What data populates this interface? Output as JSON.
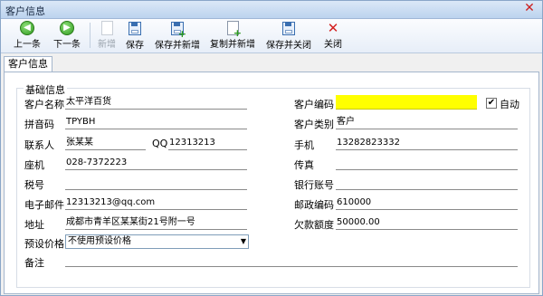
{
  "window": {
    "title": "客户信息"
  },
  "toolbar": {
    "prev_label": "上一条",
    "next_label": "下一条",
    "new_label": "新增",
    "save_label": "保存",
    "save_new_label": "保存并新增",
    "copy_new_label": "复制并新增",
    "save_close_label": "保存并关闭",
    "close_label": "关闭"
  },
  "tabs": [
    {
      "label": "客户信息"
    }
  ],
  "form": {
    "group_title": "基础信息",
    "name_label": "客户名称",
    "name_value": "太平洋百货",
    "code_label": "客户编码",
    "code_value": "",
    "auto_label": "自动",
    "auto_checked_glyph": "✔",
    "pinyin_label": "拼音码",
    "pinyin_value": "TPYBH",
    "category_label": "客户类别",
    "category_value": "客户",
    "contact_label": "联系人",
    "contact_value": "张某某",
    "qq_label": "QQ",
    "qq_value": "12313213",
    "mobile_label": "手机",
    "mobile_value": "13282823332",
    "phone_label": "座机",
    "phone_value": "028-7372223",
    "fax_label": "传真",
    "fax_value": "",
    "tax_label": "税号",
    "tax_value": "",
    "bank_label": "银行账号",
    "bank_value": "",
    "email_label": "电子邮件",
    "email_value": "12313213@qq.com",
    "postcode_label": "邮政编码",
    "postcode_value": "610000",
    "address_label": "地址",
    "address_value": "成都市青羊区某某街21号附一号",
    "credit_label": "欠款额度",
    "credit_value": "50000.00",
    "price_label": "预设价格",
    "price_value": "不使用预设价格",
    "remark_label": "备注",
    "remark_value": ""
  }
}
